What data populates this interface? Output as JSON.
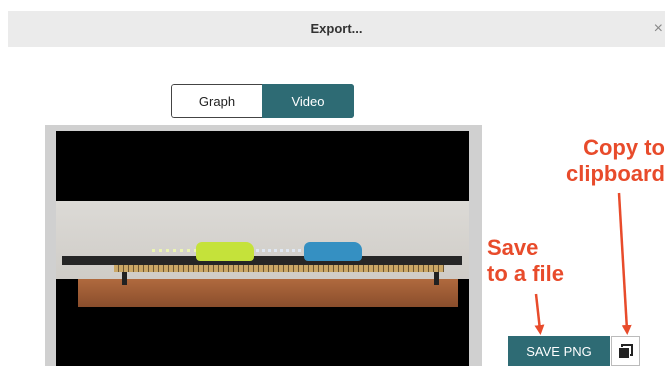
{
  "dialog": {
    "title": "Export...",
    "close_symbol": "×"
  },
  "tabs": [
    {
      "label": "Graph",
      "selected": false
    },
    {
      "label": "Video",
      "selected": true
    }
  ],
  "preview": {
    "content": "video frame: track with yellow and blue carts on table"
  },
  "annotations": {
    "copy_line1": "Copy to",
    "copy_line2": "clipboard",
    "save_line1": "Save",
    "save_line2": "to a file"
  },
  "actions": {
    "save_label": "SAVE PNG",
    "copy_icon": "copy-icon"
  },
  "colors": {
    "accent": "#2e6b74",
    "annotation": "#e84b2b"
  }
}
